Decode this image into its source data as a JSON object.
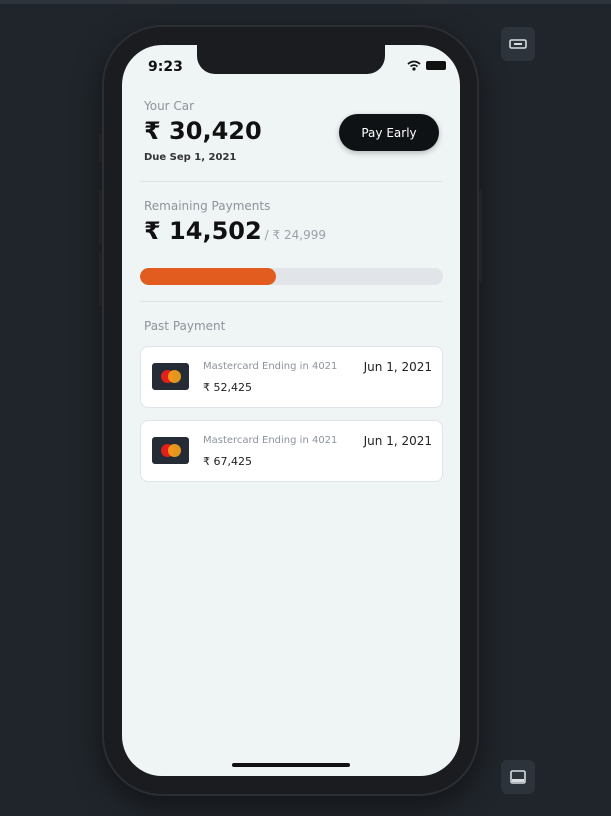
{
  "status_bar": {
    "time": "9:23",
    "wifi_icon": "wifi-icon",
    "battery_icon": "battery-icon"
  },
  "car": {
    "label": "Your Car",
    "amount": "₹ 30,420",
    "due": "Due Sep 1, 2021",
    "pay_button": "Pay Early"
  },
  "remaining": {
    "label": "Remaining Payments",
    "amount": "₹ 14,502",
    "total": "/ ₹ 24,999",
    "progress_fraction": 0.45,
    "progress_color": "#e15c1e"
  },
  "past": {
    "label": "Past Payment",
    "payments": [
      {
        "card": "Mastercard Ending in 4021",
        "amount": "₹ 52,425",
        "date": "Jun 1, 2021",
        "icon": "mastercard-icon"
      },
      {
        "card": "Mastercard Ending in 4021",
        "amount": "₹ 67,425",
        "date": "Jun 1, 2021",
        "icon": "mastercard-icon"
      }
    ]
  },
  "toolbar": {
    "top_icon": "rotate-device-icon",
    "bottom_icon": "tablet-device-icon"
  }
}
